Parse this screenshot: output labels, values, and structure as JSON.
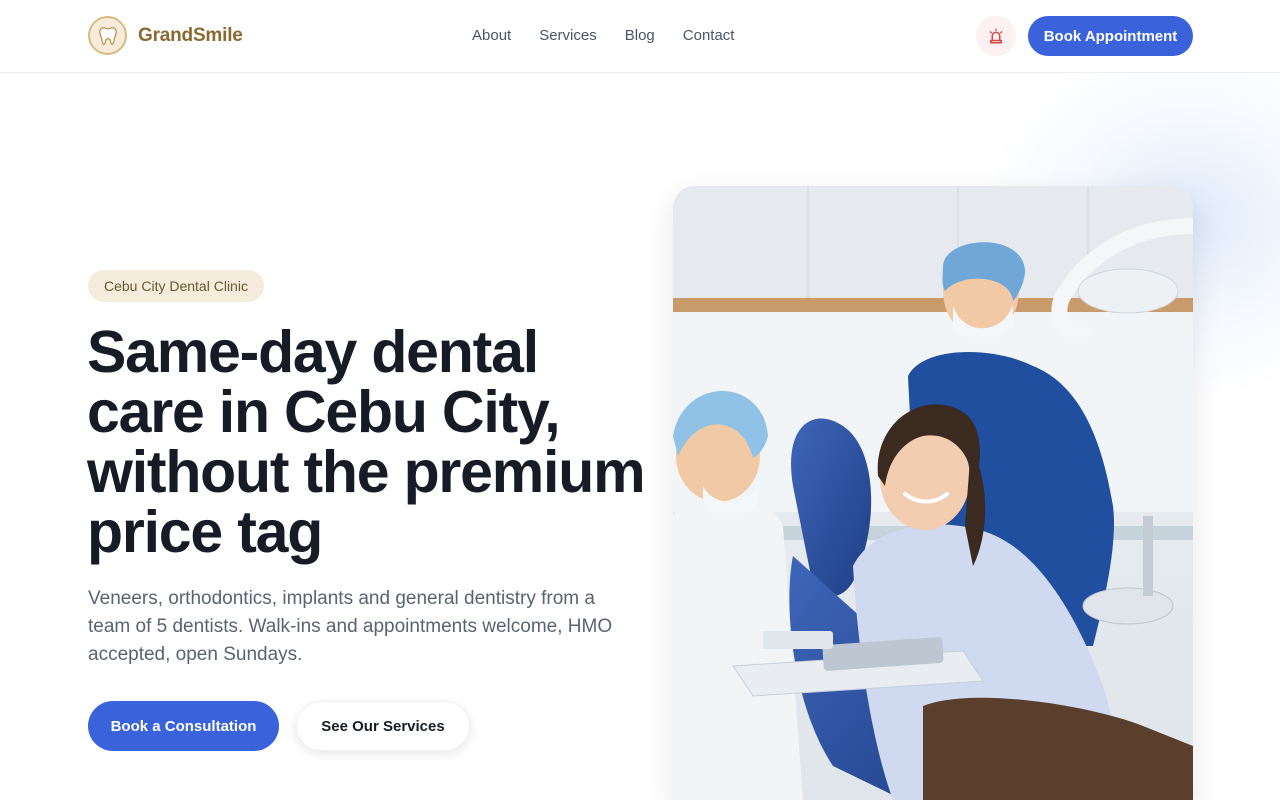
{
  "header": {
    "brand_name": "GrandSmile",
    "logo_icon": "tooth-logo-icon",
    "nav": [
      {
        "label": "About"
      },
      {
        "label": "Services"
      },
      {
        "label": "Blog"
      },
      {
        "label": "Contact"
      }
    ],
    "alert_icon": "emergency-siren-icon",
    "book_button": "Book Appointment"
  },
  "hero": {
    "badge": "Cebu City Dental Clinic",
    "headline": "Same-day dental care in Cebu City, without the premium price tag",
    "description": "Veneers, orthodontics, implants and general dentistry from a team of 5 dentists. Walk-ins and appointments welcome, HMO accepted, open Sundays.",
    "primary_cta": "Book a Consultation",
    "secondary_cta": "See Our Services",
    "image_subject": "dentists-with-smiling-patient-in-dental-chair"
  },
  "colors": {
    "accent": "#3a63db",
    "brand_gold": "#8a6a32",
    "badge_bg": "#f5ecdc",
    "headline": "#161b26",
    "alert_bg": "#fdf0f0",
    "alert_icon": "#d64545"
  }
}
